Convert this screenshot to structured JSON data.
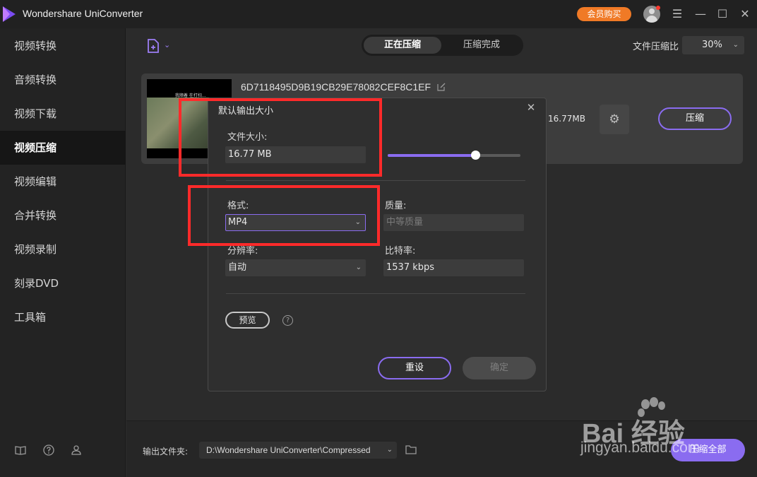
{
  "app": {
    "title": "Wondershare UniConverter",
    "vip_label": "会员购买"
  },
  "sidebar": {
    "items": [
      {
        "label": "视频转换"
      },
      {
        "label": "音频转换"
      },
      {
        "label": "视频下载"
      },
      {
        "label": "视频压缩",
        "active": true
      },
      {
        "label": "视频编辑"
      },
      {
        "label": "合并转换"
      },
      {
        "label": "视频录制"
      },
      {
        "label": "刻录DVD"
      },
      {
        "label": "工具箱"
      }
    ],
    "footer_icons": [
      "book-icon",
      "help-icon",
      "people-icon"
    ]
  },
  "toolbar": {
    "tabs": [
      {
        "label": "正在压缩",
        "active": true
      },
      {
        "label": "压缩完成"
      }
    ],
    "ratio_label": "文件压缩比",
    "ratio_value": "30%"
  },
  "file": {
    "name": "6D7118495D9B19CB29E78082CEF8C1EF",
    "thumb_subtitle": "我顺着 在打扫...",
    "size": "16.77MB",
    "compress_label": "压缩"
  },
  "dialog": {
    "title": "默认输出大小",
    "file_size_label": "文件大小:",
    "file_size_value": "16.77 MB",
    "slider_fraction": 0.66,
    "format_label": "格式:",
    "format_value": "MP4",
    "quality_label": "质量:",
    "quality_value": "中等质量",
    "resolution_label": "分辨率:",
    "resolution_value": "自动",
    "bitrate_label": "比特率:",
    "bitrate_value": "1537 kbps",
    "preview_label": "预览",
    "reset_label": "重设",
    "ok_label": "确定"
  },
  "bottom": {
    "output_label": "输出文件夹:",
    "output_path": "D:\\Wondershare UniConverter\\Compressed",
    "compress_all_label": "压缩全部"
  },
  "watermark": {
    "line1": "Bai 经验",
    "line2": "jingyan.baidu.com"
  },
  "colors": {
    "accent": "#8a6cf0",
    "vip": "#f07a26",
    "annotation": "#ff2a2a"
  }
}
